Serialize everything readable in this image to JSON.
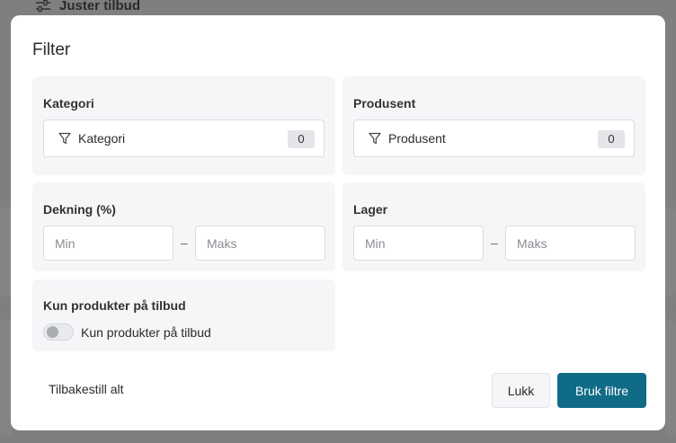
{
  "background": {
    "top_action_label": "Juster tilbud",
    "top_action_icon": "sliders-icon"
  },
  "modal": {
    "title": "Filter",
    "category": {
      "label": "Kategori",
      "select_label": "Kategori",
      "count": "0",
      "icon": "funnel-icon"
    },
    "manufacturer": {
      "label": "Produsent",
      "select_label": "Produsent",
      "count": "0",
      "icon": "funnel-icon"
    },
    "coverage": {
      "label": "Dekning (%)",
      "min_placeholder": "Min",
      "max_placeholder": "Maks",
      "min_value": "",
      "max_value": "",
      "separator": "–"
    },
    "stock": {
      "label": "Lager",
      "min_placeholder": "Min",
      "max_placeholder": "Maks",
      "min_value": "",
      "max_value": "",
      "separator": "–"
    },
    "offer_only": {
      "label": "Kun produkter på tilbud",
      "toggle_label": "Kun produkter på tilbud",
      "enabled": false
    },
    "footer": {
      "reset_label": "Tilbakestill alt",
      "close_label": "Lukk",
      "apply_label": "Bruk filtre"
    }
  },
  "colors": {
    "primary": "#106b86",
    "panel_bg": "#f5f6f8",
    "overlay": "#7f7f7f"
  }
}
